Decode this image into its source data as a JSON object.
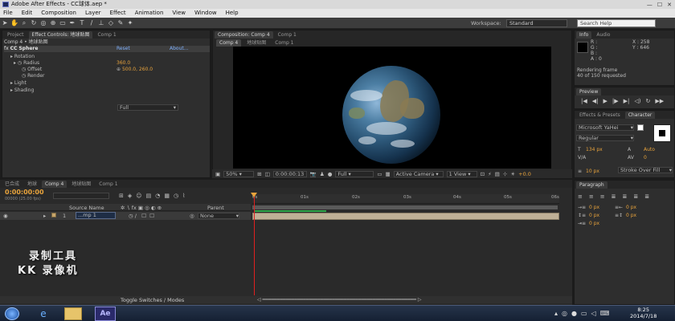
{
  "window": {
    "title": "Adobe After Effects - CC球体.aep *",
    "min": "—",
    "max": "☐",
    "close": "✕"
  },
  "menu": [
    "File",
    "Edit",
    "Composition",
    "Layer",
    "Effect",
    "Animation",
    "View",
    "Window",
    "Help"
  ],
  "toolbar": {
    "workspace_label": "Workspace:",
    "workspace_value": "Standard",
    "search_placeholder": "Search Help"
  },
  "left_panel": {
    "tabs": [
      "Project",
      "Effect Controls: 地球贴图",
      "Comp 1"
    ],
    "breadcrumb": "Comp 4 • 地球贴图",
    "effect_name": "CC Sphere",
    "reset": "Reset",
    "about": "About...",
    "rows": [
      {
        "label": "Rotation",
        "value": ""
      },
      {
        "label": "Radius",
        "value": "360.0"
      },
      {
        "label": "Offset",
        "value": "500.0, 260.0"
      },
      {
        "label": "Render",
        "value": "Full"
      },
      {
        "label": "Light",
        "value": ""
      },
      {
        "label": "Shading",
        "value": ""
      }
    ]
  },
  "composition": {
    "tabs": [
      "Composition: Comp 4",
      "Comp 1"
    ],
    "subtabs": [
      "Comp 4",
      "地球贴图",
      "Comp 1"
    ],
    "zoom": "50%",
    "timecode": "0:00:00:13",
    "resolution": "Full",
    "camera": "Active Camera",
    "views": "1 View",
    "exposure": "+0.0"
  },
  "info": {
    "tabs": [
      "Info",
      "Audio"
    ],
    "rgba": [
      "R :",
      "G :",
      "B :",
      "A : 0"
    ],
    "coords": [
      "X : 258",
      "Y : 646"
    ],
    "status1": "Rendering frame",
    "status2": "40 of 150 requested"
  },
  "preview": {
    "tab": "Preview"
  },
  "character": {
    "tabs": [
      "Effects & Presets",
      "Character"
    ],
    "font": "Microsoft YaHei",
    "style": "Regular",
    "size": "134 px",
    "leading": "Auto",
    "kerning": "",
    "tracking": "0",
    "stroke_width": "10 px",
    "stroke_mode": "Stroke Over Fill"
  },
  "paragraph": {
    "tab": "Paragraph",
    "v1": "0 px",
    "v2": "0 px",
    "v3": "0 px",
    "v4": "0 px",
    "v5": "0 px"
  },
  "timeline": {
    "tabs": [
      "已合成",
      "地球",
      "Comp 4",
      "地球贴图",
      "Comp 1"
    ],
    "timecode": "0:00:00:00",
    "frames": "00000 (25.00 fps)",
    "columns": {
      "source": "Source Name",
      "parent": "Parent"
    },
    "layer": {
      "index": "1",
      "name": "...mp 1",
      "parent": "None"
    },
    "ruler": [
      "0s",
      "01s",
      "02s",
      "03s",
      "04s",
      "05s",
      "06s"
    ],
    "toggle": "Toggle Switches / Modes"
  },
  "watermark": {
    "line1": "录制工具",
    "line2": "KK 录像机"
  },
  "taskbar": {
    "time": "8:25",
    "date": "2014/7/18",
    "ae_label": "Ae"
  }
}
